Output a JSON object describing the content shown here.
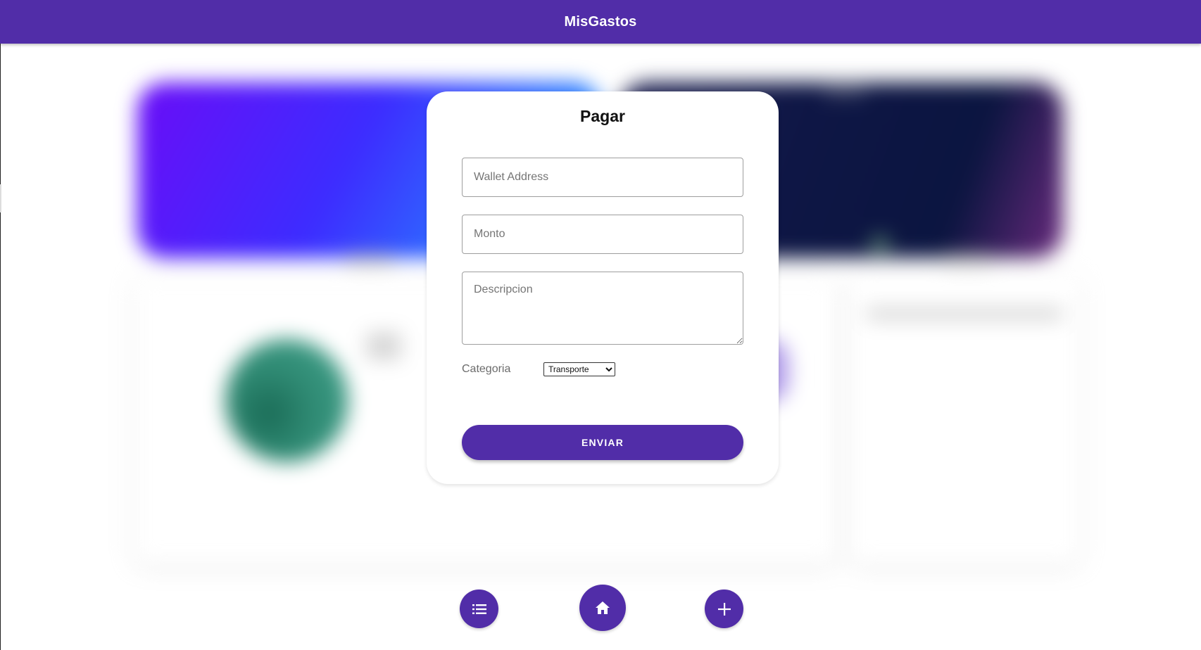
{
  "app": {
    "title": "MisGastos",
    "brand_color": "#512da8"
  },
  "modal": {
    "title": "Pagar",
    "wallet_placeholder": "Wallet Address",
    "wallet_value": "",
    "monto_placeholder": "Monto",
    "monto_value": "",
    "descripcion_placeholder": "Descripcion",
    "descripcion_value": "",
    "categoria_label": "Categoria",
    "categoria_selected": "Transporte",
    "submit_label": "ENVIAR"
  },
  "bottom_nav": {
    "items": [
      {
        "icon": "list-icon"
      },
      {
        "icon": "home-icon"
      },
      {
        "icon": "plus-icon"
      }
    ]
  }
}
